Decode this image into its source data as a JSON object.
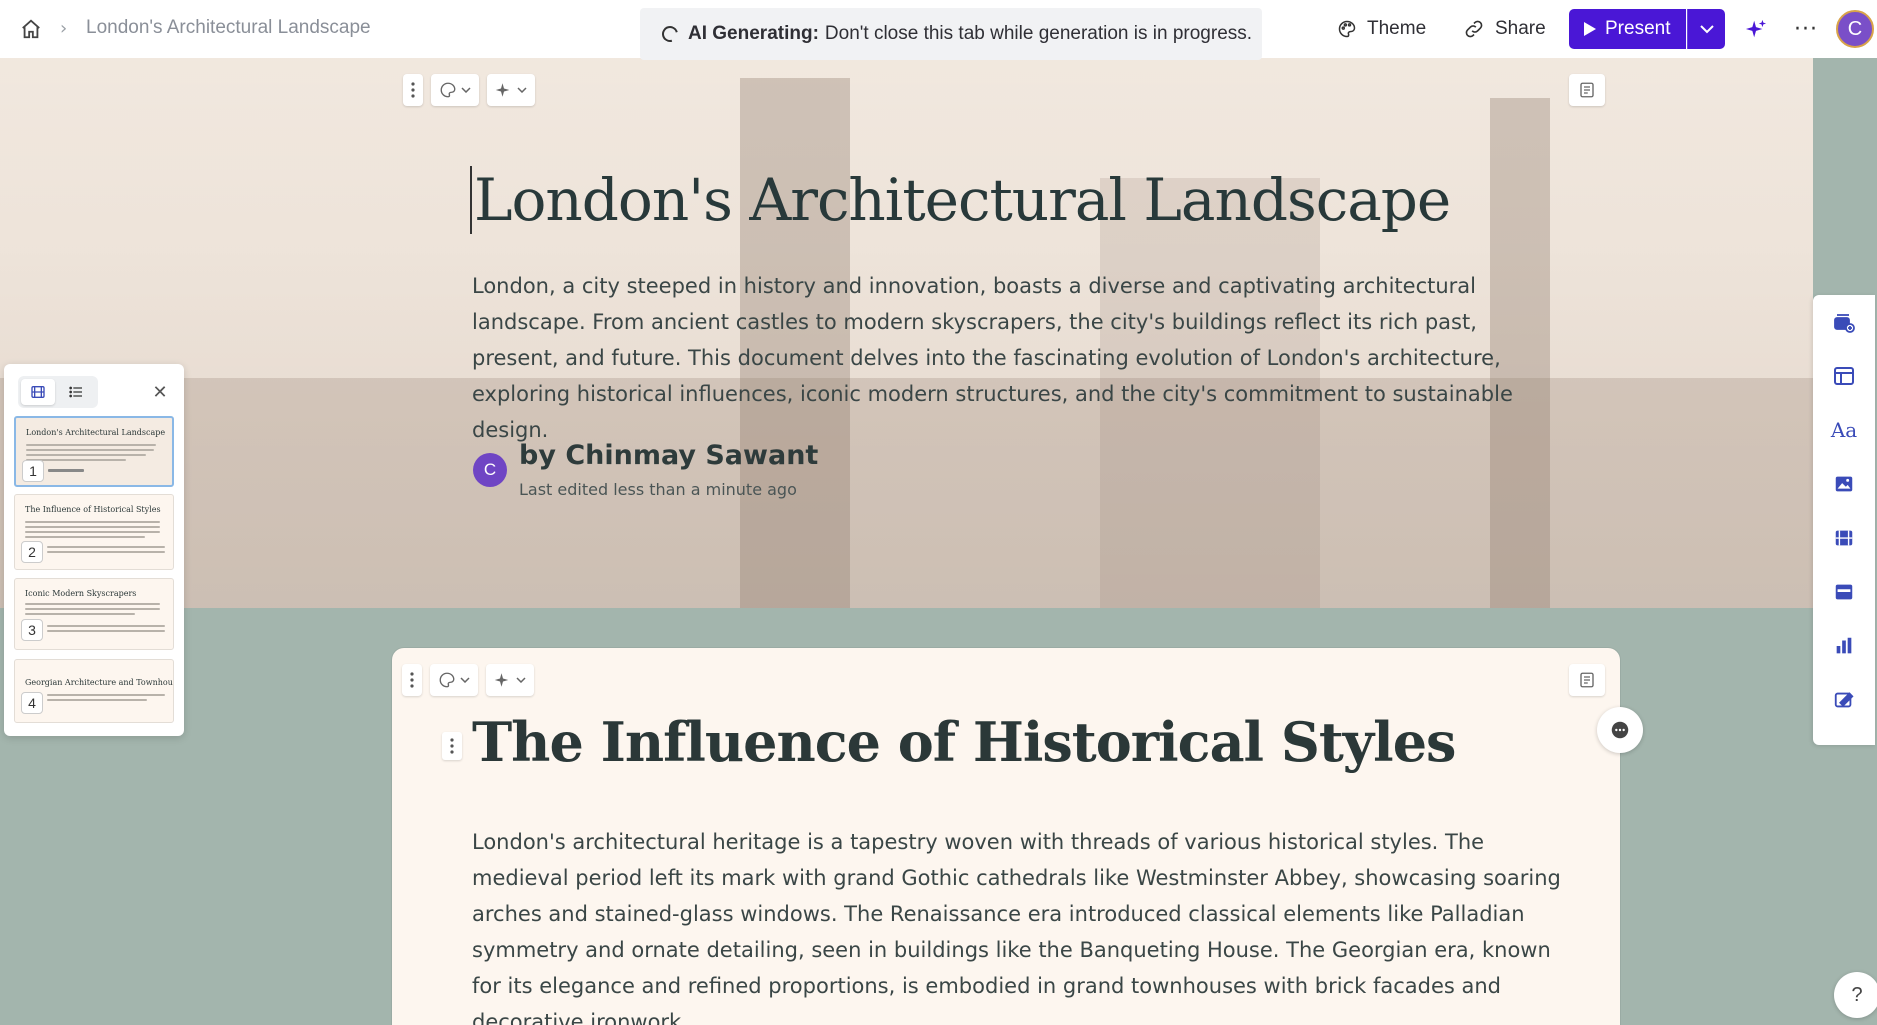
{
  "topbar": {
    "breadcrumb_title": "London's Architectural Landscape",
    "ai_banner_bold": "AI Generating:",
    "ai_banner_text": "Don't close this tab while generation is in progress.",
    "theme_label": "Theme",
    "share_label": "Share",
    "present_label": "Present",
    "user_initial": "C"
  },
  "hero": {
    "title": "London's Architectural Landscape",
    "body": "London, a city steeped in history and innovation, boasts a diverse and captivating architectural landscape. From ancient castles to modern skyscrapers, the city's buildings reflect its rich past, present, and future. This document delves into the fascinating evolution of London's architecture, exploring historical influences, iconic modern structures, and the city's commitment to sustainable design.",
    "author_initial": "C",
    "author": "by Chinmay Sawant",
    "last_edited": "Last edited less than a minute ago"
  },
  "card2": {
    "title": "The Influence of Historical Styles",
    "body": "London's architectural heritage is a tapestry woven with threads of various historical styles. The medieval period left its mark with grand Gothic cathedrals like Westminster Abbey, showcasing soaring arches and stained-glass windows. The Renaissance era introduced classical elements like Palladian symmetry and ornate detailing, seen in buildings like the Banqueting House. The Georgian era, known for its elegance and refined proportions, is embodied in grand townhouses with brick facades and decorative ironwork."
  },
  "slide_panel": {
    "thumbs": [
      {
        "num": "1",
        "title": "London's Architectural Landscape"
      },
      {
        "num": "2",
        "title": "The Influence of Historical Styles"
      },
      {
        "num": "3",
        "title": "Iconic Modern Skyscrapers"
      },
      {
        "num": "4",
        "title": "Georgian Architecture and Townhouses"
      }
    ]
  },
  "help_label": "?",
  "colors": {
    "accent": "#4a17d6",
    "page_bg": "#a3b5ad",
    "card_bg": "#fdf6ef",
    "rail_icon": "#3a4bb8"
  }
}
